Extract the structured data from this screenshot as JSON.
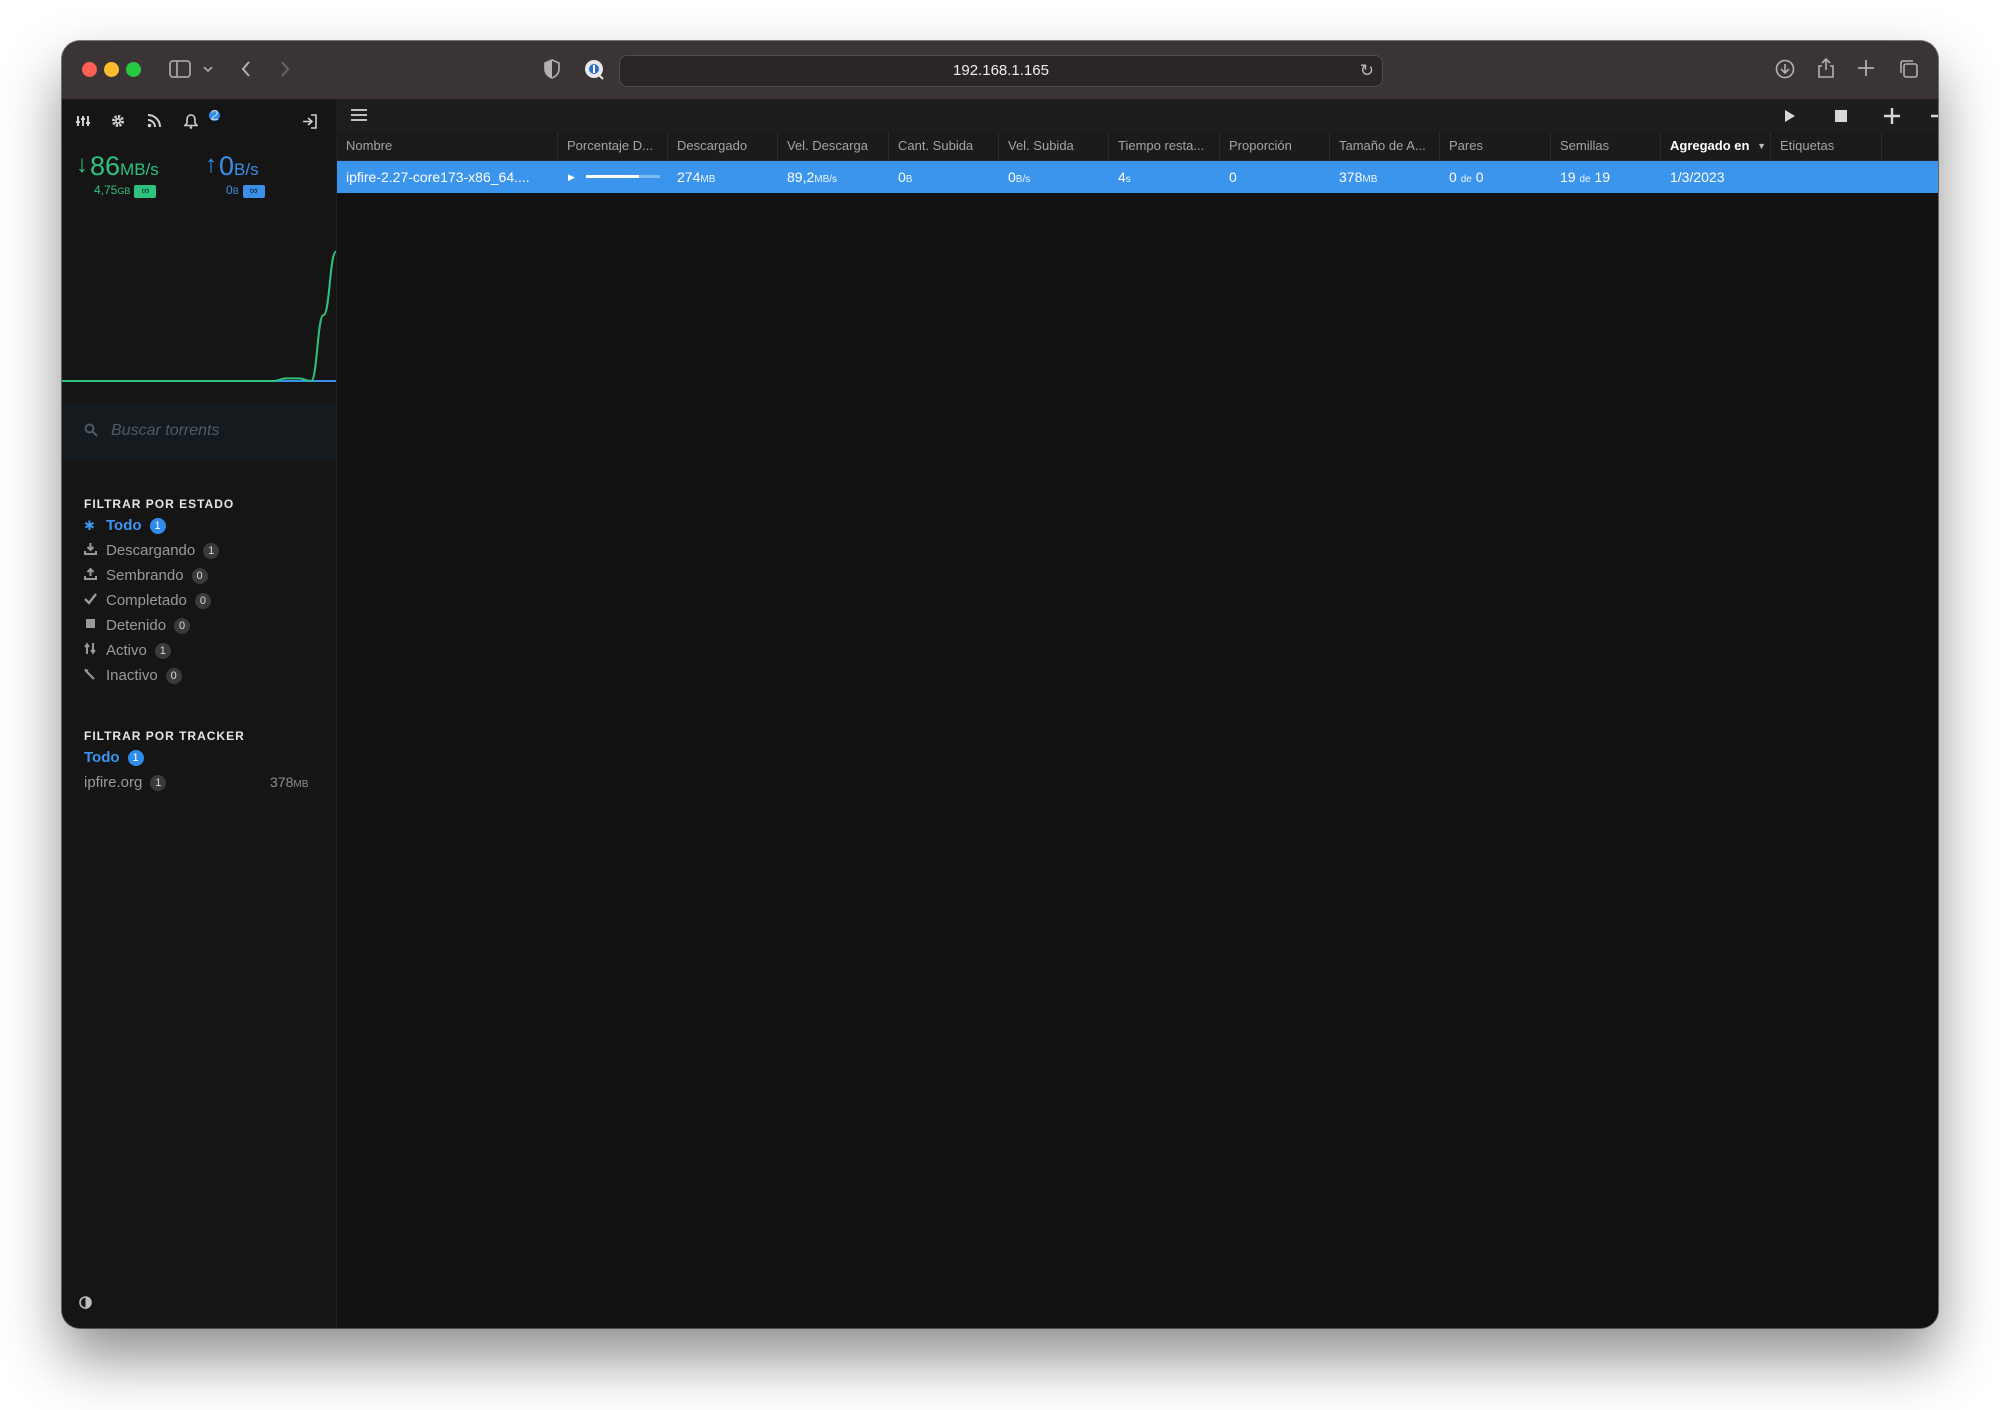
{
  "browser": {
    "url": "192.168.1.165"
  },
  "colors": {
    "accent": "#3b95ec",
    "download_green": "#2ec27e",
    "upload_blue": "#3b8fe9"
  },
  "sidebar": {
    "notifications_count": "2",
    "download": {
      "arrow": "↓",
      "value": "86",
      "unit": "MB/s",
      "total": "4,75",
      "total_unit": "GB",
      "limit": "∞"
    },
    "upload": {
      "arrow": "↑",
      "value": "0",
      "unit": "B/s",
      "total": "0",
      "total_unit": "B",
      "limit": "∞"
    },
    "search_placeholder": "Buscar torrents",
    "status_filter": {
      "title": "FILTRAR POR ESTADO",
      "items": [
        {
          "label": "Todo",
          "count": "1",
          "icon": "asterisk-icon"
        },
        {
          "label": "Descargando",
          "count": "1",
          "icon": "download-icon"
        },
        {
          "label": "Sembrando",
          "count": "0",
          "icon": "upload-icon"
        },
        {
          "label": "Completado",
          "count": "0",
          "icon": "check-icon"
        },
        {
          "label": "Detenido",
          "count": "0",
          "icon": "stop-icon"
        },
        {
          "label": "Activo",
          "count": "1",
          "icon": "active-icon"
        },
        {
          "label": "Inactivo",
          "count": "0",
          "icon": "inactive-icon"
        }
      ]
    },
    "tracker_filter": {
      "title": "FILTRAR POR TRACKER",
      "items": [
        {
          "label": "Todo",
          "count": "1"
        },
        {
          "label": "ipfire.org",
          "count": "1",
          "size": "378",
          "size_unit": "MB"
        }
      ]
    },
    "speed_graph": {
      "download_series": [
        0,
        0,
        0,
        0,
        0,
        0,
        0,
        0,
        0,
        0,
        0,
        0,
        0,
        0,
        0,
        0,
        0,
        0,
        0.02,
        0.02,
        0,
        0.5,
        0.98
      ],
      "upload_series": [
        0,
        0,
        0,
        0,
        0,
        0,
        0,
        0,
        0,
        0,
        0,
        0,
        0,
        0,
        0,
        0,
        0,
        0,
        0,
        0,
        0,
        0,
        0
      ]
    }
  },
  "table": {
    "columns": [
      {
        "key": "name",
        "label": "Nombre"
      },
      {
        "key": "percent",
        "label": "Porcentaje D..."
      },
      {
        "key": "downloaded",
        "label": "Descargado"
      },
      {
        "key": "dl_speed",
        "label": "Vel. Descarga"
      },
      {
        "key": "uploaded",
        "label": "Cant. Subida"
      },
      {
        "key": "ul_speed",
        "label": "Vel. Subida"
      },
      {
        "key": "eta",
        "label": "Tiempo resta..."
      },
      {
        "key": "ratio",
        "label": "Proporción"
      },
      {
        "key": "size",
        "label": "Tamaño de A..."
      },
      {
        "key": "peers",
        "label": "Pares"
      },
      {
        "key": "seeds",
        "label": "Semillas"
      },
      {
        "key": "added",
        "label": "Agregado en"
      },
      {
        "key": "labels",
        "label": "Etiquetas"
      }
    ],
    "sorted_column": "Agregado en",
    "rows": [
      {
        "name": "ipfire-2.27-core173-x86_64....",
        "progress": 0.72,
        "downloaded": "274",
        "downloaded_unit": "MB",
        "dl_speed": "89,2",
        "dl_speed_unit": "MB/s",
        "uploaded": "0",
        "uploaded_unit": "B",
        "ul_speed": "0",
        "ul_speed_unit": "B/s",
        "eta": "4",
        "eta_unit": "s",
        "ratio": "0",
        "size": "378",
        "size_unit": "MB",
        "peers": "0",
        "peers_sep": "de",
        "peers_total": "0",
        "seeds": "19",
        "seeds_sep": "de",
        "seeds_total": "19",
        "added": "1/3/2023",
        "labels": ""
      }
    ]
  }
}
